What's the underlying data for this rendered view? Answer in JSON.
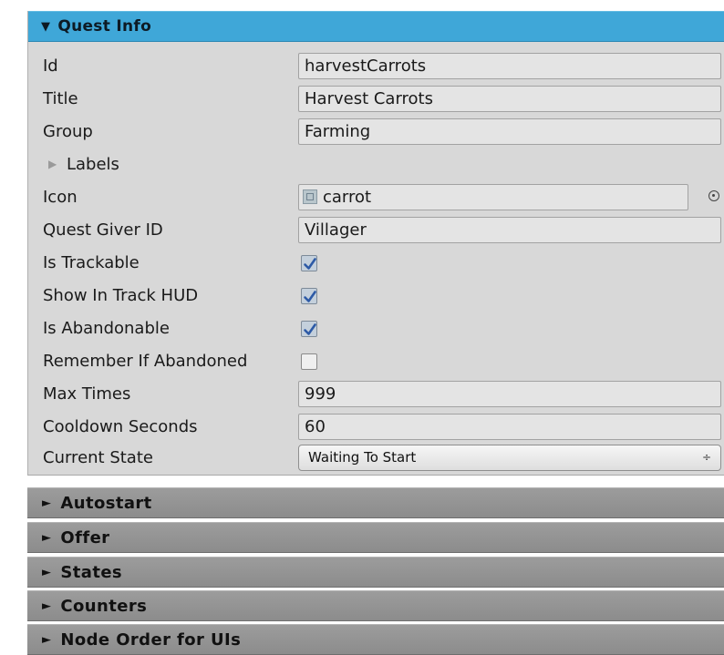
{
  "header": {
    "arrow": "▼",
    "title": "Quest Info"
  },
  "fields": {
    "id": {
      "label": "Id",
      "value": "harvestCarrots"
    },
    "title": {
      "label": "Title",
      "value": "Harvest Carrots"
    },
    "group": {
      "label": "Group",
      "value": "Farming"
    },
    "labels": {
      "arrow": "▶",
      "label": "Labels"
    },
    "icon": {
      "label": "Icon",
      "value": "carrot",
      "icon": "object-icon",
      "picker_icon": "object-picker-icon"
    },
    "quest_giver_id": {
      "label": "Quest Giver ID",
      "value": "Villager"
    },
    "is_trackable": {
      "label": "Is Trackable",
      "checked": true
    },
    "show_in_track_hud": {
      "label": "Show In Track HUD",
      "checked": true
    },
    "is_abandonable": {
      "label": "Is Abandonable",
      "checked": true
    },
    "remember_if_abandoned": {
      "label": "Remember If Abandoned",
      "checked": false
    },
    "max_times": {
      "label": "Max Times",
      "value": "999"
    },
    "cooldown_seconds": {
      "label": "Cooldown Seconds",
      "value": "60"
    },
    "current_state": {
      "label": "Current State",
      "value": "Waiting To Start",
      "arrows": "÷"
    }
  },
  "sections": [
    {
      "arrow": "►",
      "label": "Autostart"
    },
    {
      "arrow": "►",
      "label": "Offer"
    },
    {
      "arrow": "►",
      "label": "States"
    },
    {
      "arrow": "►",
      "label": "Counters"
    },
    {
      "arrow": "►",
      "label": "Node Order for UIs"
    }
  ],
  "colors": {
    "header_bg": "#3fa7d8",
    "panel_bg": "#d8d8d8",
    "section_bg": "#949494",
    "checkbox_check": "#2d5aa6"
  }
}
